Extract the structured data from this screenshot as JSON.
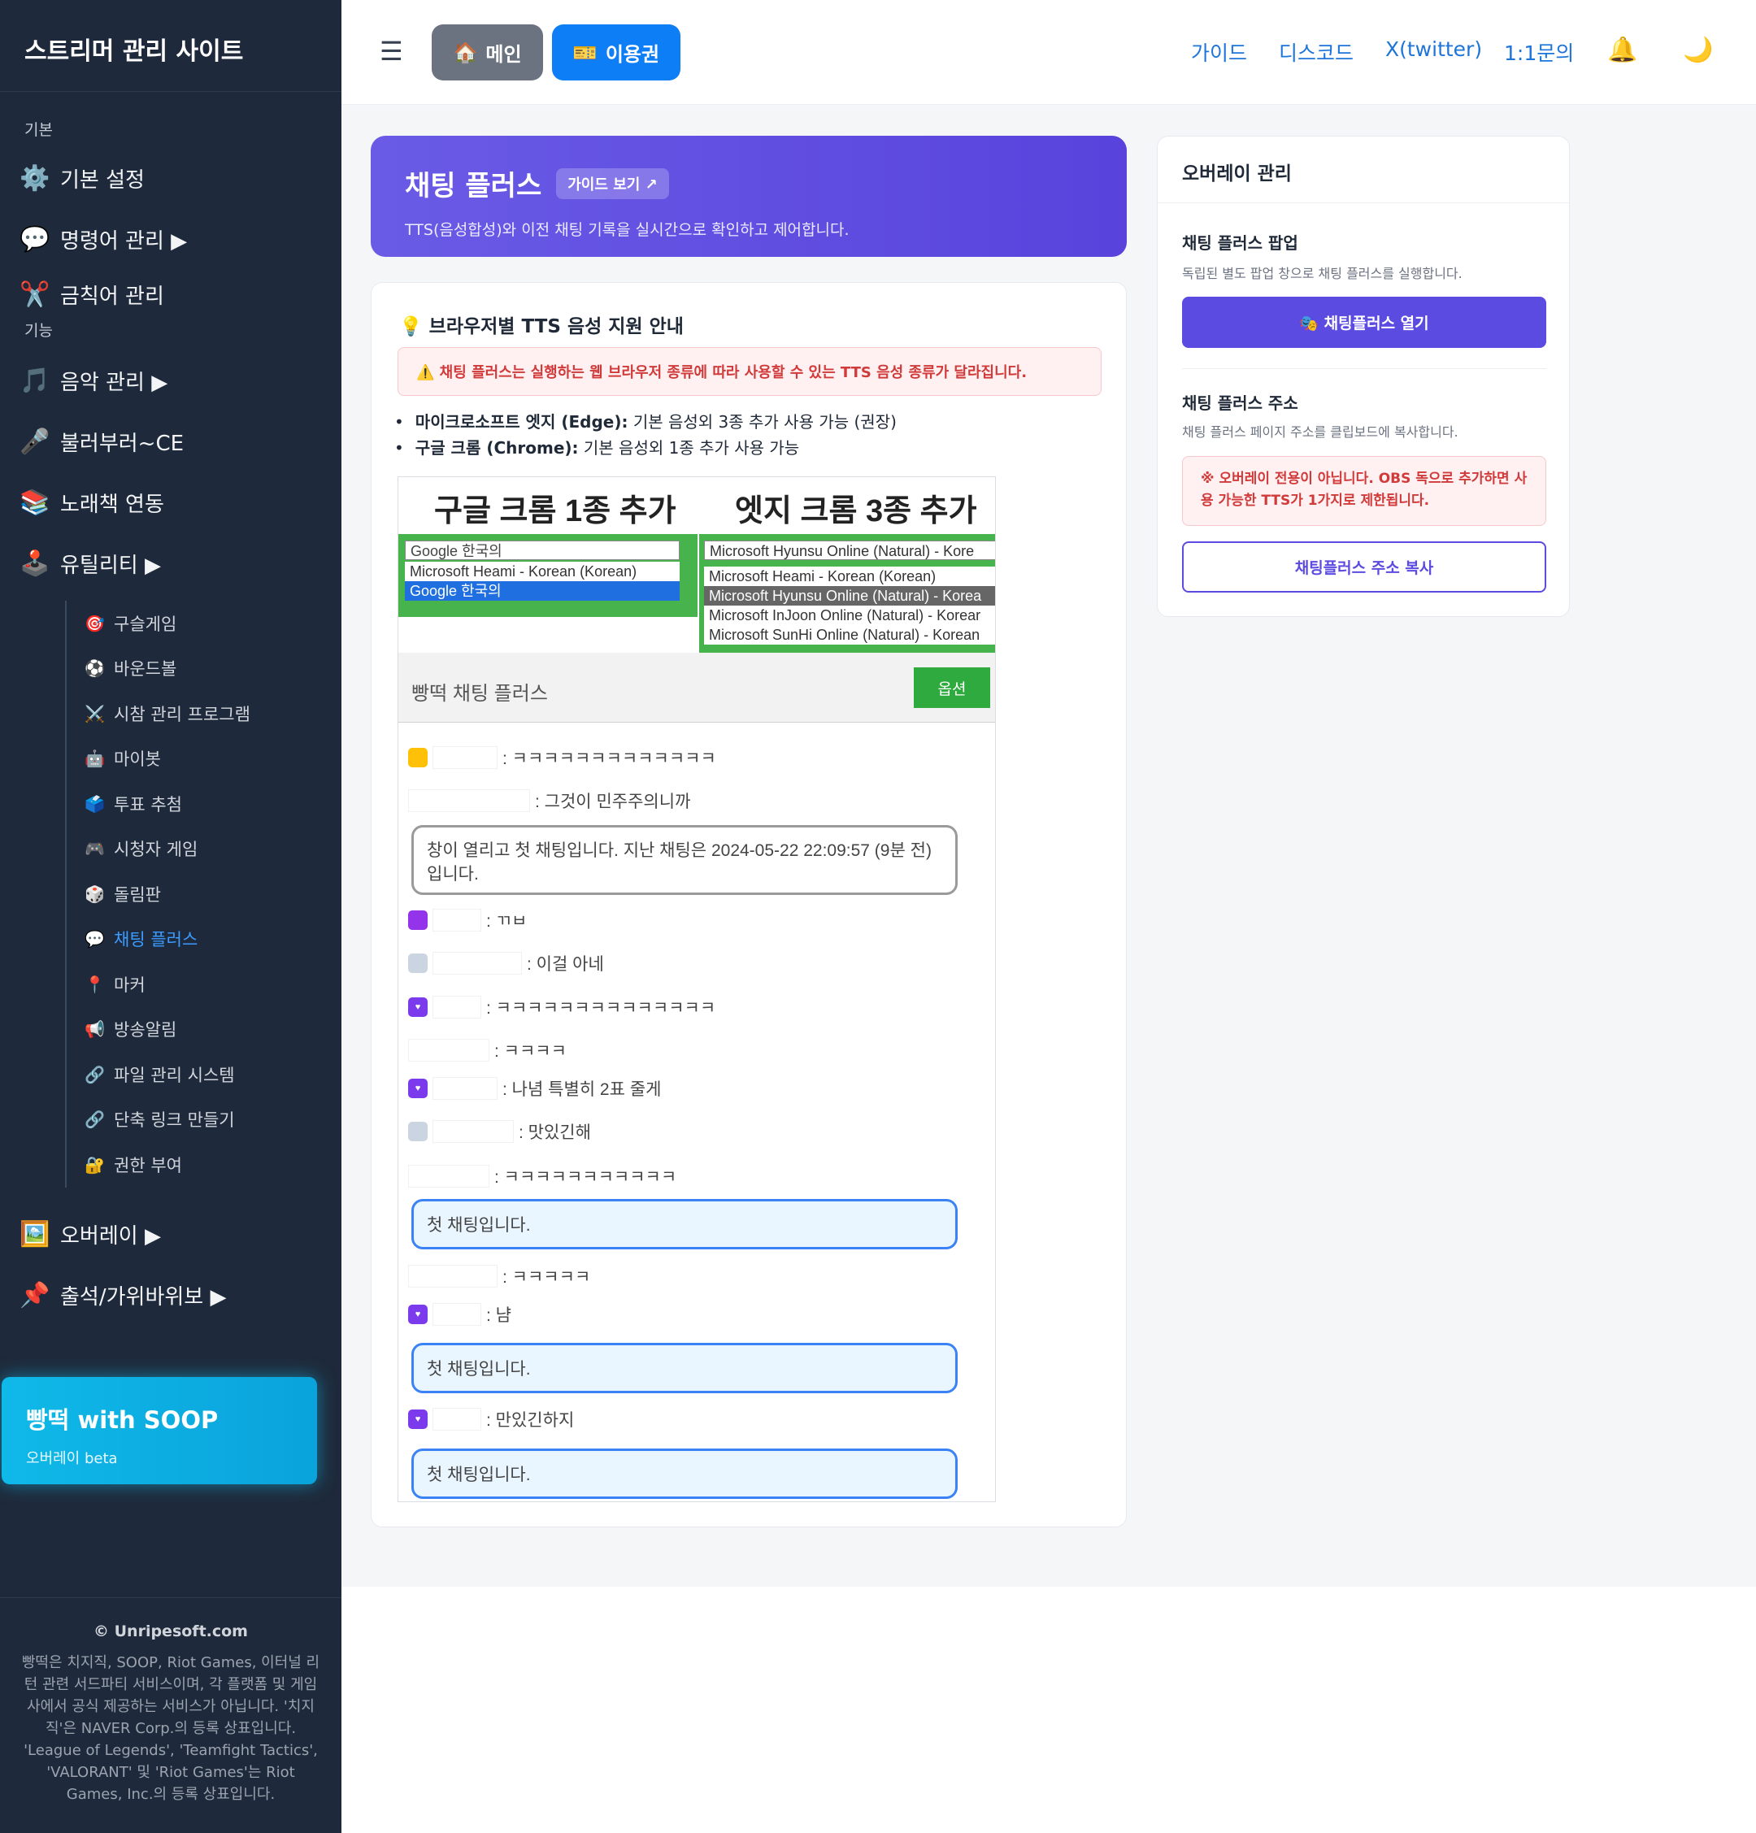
{
  "sidebar": {
    "title": "스트리머 관리 사이트",
    "section_basic": "기본",
    "section_function": "기능",
    "items": [
      {
        "icon": "⚙️",
        "label": "기본 설정"
      },
      {
        "icon": "💬",
        "label": "명령어 관리 ▶"
      },
      {
        "icon": "✂️",
        "label": "금칙어 관리"
      },
      {
        "icon": "🎵",
        "label": "음악 관리 ▶"
      },
      {
        "icon": "🎤",
        "label": "불러부러~CE"
      },
      {
        "icon": "📚",
        "label": "노래책 연동"
      },
      {
        "icon": "🕹️",
        "label": "유틸리티 ▶"
      }
    ],
    "subitems": [
      {
        "icon": "🎯",
        "label": "구슬게임"
      },
      {
        "icon": "⚽",
        "label": "바운드볼"
      },
      {
        "icon": "⚔️",
        "label": "시참 관리 프로그램"
      },
      {
        "icon": "🤖",
        "label": "마이봇"
      },
      {
        "icon": "🗳️",
        "label": "투표 추첨"
      },
      {
        "icon": "🎮",
        "label": "시청자 게임"
      },
      {
        "icon": "🎲",
        "label": "돌림판"
      },
      {
        "icon": "💬",
        "label": "채팅 플러스"
      },
      {
        "icon": "📍",
        "label": "마커"
      },
      {
        "icon": "📢",
        "label": "방송알림"
      },
      {
        "icon": "🔗",
        "label": "파일 관리 시스템"
      },
      {
        "icon": "🔗",
        "label": "단축 링크 만들기"
      },
      {
        "icon": "🔐",
        "label": "권한 부여"
      }
    ],
    "items2": [
      {
        "icon": "🖼️",
        "label": "오버레이 ▶"
      },
      {
        "icon": "📌",
        "label": "출석/가위바위보 ▶"
      }
    ],
    "promo": {
      "title": "빵떡 with SOOP",
      "subtitle": "오버레이 beta"
    },
    "footer": {
      "copyright": "© Unripesoft.com",
      "disclaimer": "빵떡은 치지직, SOOP, Riot Games, 이터널 리턴 관련 서드파티 서비스이며, 각 플랫폼 및 게임사에서 공식 제공하는 서비스가 아닙니다. '치지직'은 NAVER Corp.의 등록 상표입니다. 'League of Legends', 'Teamfight Tactics', 'VALORANT' 및 'Riot Games'는 Riot Games, Inc.의 등록 상표입니다."
    }
  },
  "header": {
    "menu_icon": "☰",
    "main_icon": "🏠",
    "main_label": "메인",
    "ticket_icon": "🎫",
    "ticket_label": "이용권",
    "links": [
      "가이드",
      "디스코드",
      "X(twitter)",
      "1:1문의"
    ],
    "bell_icon": "🔔",
    "theme_icon": "🌙"
  },
  "banner": {
    "title": "채팅 플러스",
    "guide_button": "가이드 보기 ↗",
    "description": "TTS(음성합성)와 이전 채팅 기록을 실시간으로 확인하고 제어합니다."
  },
  "browser_card": {
    "icon": "💡",
    "title": "브라우저별 TTS 음성 지원 안내",
    "warning": "⚠️ 채팅 플러스는 실행하는 웹 브라우저 종류에 따라 사용할 수 있는 TTS 음성 종류가 달라집니다.",
    "bullets": [
      {
        "bold": "마이크로소프트 엣지 (Edge):",
        "text": " 기본 음성외 3종 추가 사용 가능 (권장)"
      },
      {
        "bold": "구글 크롬 (Chrome):",
        "text": " 기본 음성외 1종 추가 사용 가능"
      }
    ],
    "screenshot": {
      "left_heading": "구글 크롬 1종 추가",
      "right_heading": "엣지 크롬 3종 추가",
      "chrome_options": [
        "Google 한국의",
        "Microsoft Heami - Korean (Korean)",
        "Google 한국의"
      ],
      "edge_options": [
        "Microsoft Hyunsu Online (Natural) - Kore",
        "Microsoft Heami - Korean (Korean)",
        "Microsoft Hyunsu Online (Natural) - Korea",
        "Microsoft InJoon Online (Natural) - Korear",
        "Microsoft SunHi Online (Natural) - Korean"
      ],
      "chat_title": "빵떡 채팅 플러스",
      "options_button": "옵션",
      "messages": [
        ": ㅋㅋㅋㅋㅋㅋㅋㅋㅋㅋㅋㅋㅋ",
        ": 그것이 민주주의니까",
        "창이 열리고 첫 채팅입니다. 지난 채팅은 2024-05-22 22:09:57 (9분 전)입니다.",
        ": ㄲㅂ",
        ": 이걸 아네",
        ": ㅋㅋㅋㅋㅋㅋㅋㅋㅋㅋㅋㅋㅋㅋ",
        ": ㅋㅋㅋㅋ",
        ": 나념 특별히 2표 줄게",
        ": 맛있긴해",
        ": ㅋㅋㅋㅋㅋㅋㅋㅋㅋㅋㅋ",
        "첫 채팅입니다.",
        ": ㅋㅋㅋㅋㅋ",
        ": 냠",
        "첫 채팅입니다.",
        ": 만있긴하지",
        "첫 채팅입니다."
      ]
    }
  },
  "overlay_card": {
    "title": "오버레이 관리",
    "popup_title": "채팅 플러스 팝업",
    "popup_desc": "독립된 별도 팝업 창으로 채팅 플러스를 실행합니다.",
    "open_button": "🎭 채팅플러스 열기",
    "address_title": "채팅 플러스 주소",
    "address_desc": "채팅 플러스 페이지 주소를 클립보드에 복사합니다.",
    "address_warning": "※ 오버레이 전용이 아닙니다. OBS 독으로 추가하면 사용 가능한 TTS가 1가지로 제한됩니다.",
    "copy_button": "채팅플러스 주소 복사"
  }
}
